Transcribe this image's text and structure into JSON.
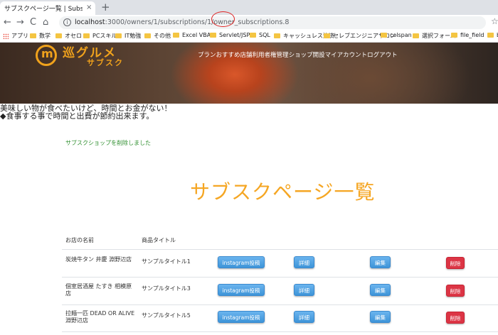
{
  "browser": {
    "tab_title": "サブスクページ一覧 | Subscription_",
    "tab_close": "×",
    "new_tab": "+",
    "back": "←",
    "forward": "→",
    "reload": "C",
    "home": "⌂",
    "url_host": "localhost",
    "url_path": ":3000/owners/1/subscriptions/1/owner_subscriptions.8",
    "bookmarks": [
      "アプリ",
      "数学",
      "オセロ",
      "PCスキル",
      "IT勉強",
      "その他",
      "Excel VBA",
      "Servlet/JSP",
      "SQL",
      "キャッシュレス決済",
      "セレブエンジニアサロン",
      "colspan",
      "選択フォーム",
      "file_field",
      "b"
    ]
  },
  "site": {
    "logo_main": "巡グルメ",
    "logo_sub": "サブスク",
    "nav_items": [
      "プラン",
      "おすすめ店舗",
      "利用者",
      "権管理",
      "ショップ",
      "開設",
      "マイアカウント",
      "ログアウト"
    ],
    "tagline_line1": "美味しい物が食べたいけど、時間とお金がない！",
    "tagline_line2": "◆食事する事で時間と出費が節約出来ます。"
  },
  "flash_message": "サブスクショップを削除しました",
  "page_title": "サブスクページ一覧",
  "table": {
    "headers": [
      "お店の名前",
      "商品タイトル"
    ],
    "buttons": {
      "instagram": "instagram投稿",
      "detail": "詳細",
      "edit": "編集",
      "delete": "削除"
    },
    "rows": [
      {
        "name": "炭焼牛タン 井慶 淵野辺店",
        "title": "サンプルタイトル1"
      },
      {
        "name": "個室居酒屋 たすき 相模原店",
        "title": "サンプルタイトル3"
      },
      {
        "name": "拉麺一匹 DEAD OR ALIVE 淵野辺店",
        "title": "サンプルタイトル5"
      }
    ]
  },
  "colors": {
    "accent": "#f5a623",
    "button_blue": "#4a9fe0",
    "button_red": "#dc3545",
    "flash_green": "#2f8f2f"
  }
}
